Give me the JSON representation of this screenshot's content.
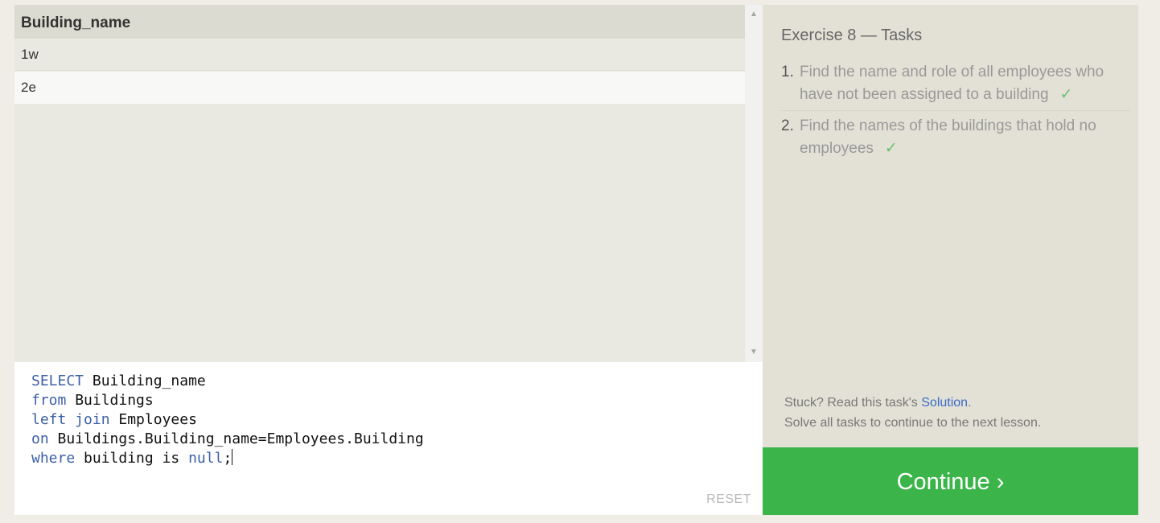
{
  "results": {
    "column_header": "Building_name",
    "rows": [
      "1w",
      "2e"
    ]
  },
  "editor": {
    "lines": [
      [
        {
          "t": "SELECT",
          "k": true
        },
        {
          "t": " Building_name",
          "k": false
        }
      ],
      [
        {
          "t": "from",
          "k": true
        },
        {
          "t": " Buildings",
          "k": false
        }
      ],
      [
        {
          "t": "left join",
          "k": true
        },
        {
          "t": " Employees",
          "k": false
        }
      ],
      [
        {
          "t": "on",
          "k": true
        },
        {
          "t": " Buildings.Building_name=Employees.Building",
          "k": false
        }
      ],
      [
        {
          "t": "where",
          "k": true
        },
        {
          "t": " building ",
          "k": false
        },
        {
          "t": "is",
          "k": false
        },
        {
          "t": " ",
          "k": false
        },
        {
          "t": "null",
          "k": true
        },
        {
          "t": ";",
          "k": false
        }
      ]
    ],
    "reset_label": "RESET"
  },
  "tasks": {
    "title": "Exercise 8 — Tasks",
    "items": [
      {
        "number": "1.",
        "text": "Find the name and role of all employees who have not been assigned to a building",
        "done": true
      },
      {
        "number": "2.",
        "text": "Find the names of the buildings that hold no employees",
        "done": true
      }
    ],
    "check_mark": "✓",
    "stuck_prefix": "Stuck? Read this task's ",
    "solution_link": "Solution",
    "stuck_suffix": ".",
    "solve_all_text": "Solve all tasks to continue to the next lesson."
  },
  "continue_label": "Continue ›",
  "colors": {
    "keyword": "#3d5fa8",
    "continue_bg": "#3bb54a",
    "check": "#6cc070",
    "link": "#3a6bc5"
  }
}
